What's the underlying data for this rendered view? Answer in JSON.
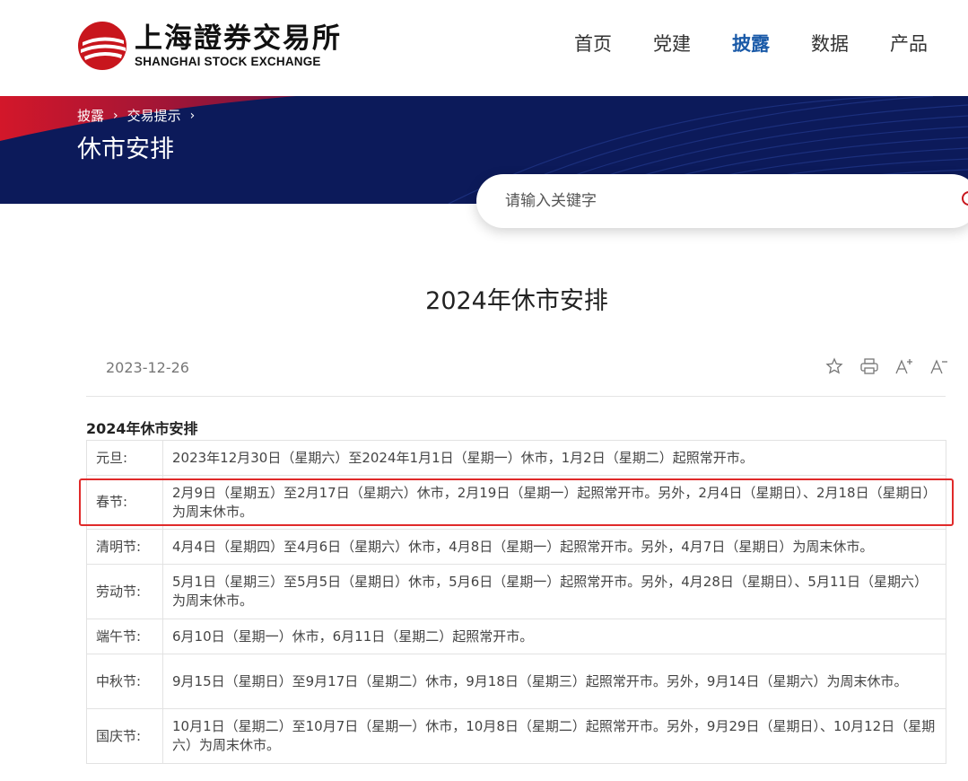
{
  "header": {
    "logo_cn": "上海證券交易所",
    "logo_en": "SHANGHAI STOCK EXCHANGE",
    "nav": [
      {
        "label": "首页",
        "active": false
      },
      {
        "label": "党建",
        "active": false
      },
      {
        "label": "披露",
        "active": true
      },
      {
        "label": "数据",
        "active": false
      },
      {
        "label": "产品",
        "active": false
      }
    ]
  },
  "banner": {
    "breadcrumb": [
      "披露",
      "交易提示"
    ],
    "title": "休市安排"
  },
  "search": {
    "placeholder": "请输入关键字",
    "icon": "search-icon"
  },
  "article": {
    "title": "2024年休市安排",
    "date": "2023-12-26",
    "tools": [
      "star-icon",
      "print-icon",
      "font-increase-icon",
      "font-decrease-icon"
    ],
    "table_caption": "2024年休市安排",
    "rows": [
      {
        "name": "元旦:",
        "desc": "2023年12月30日（星期六）至2024年1月1日（星期一）休市，1月2日（星期二）起照常开市。"
      },
      {
        "name": "春节:",
        "desc": "2月9日（星期五）至2月17日（星期六）休市，2月19日（星期一）起照常开市。另外，2月4日（星期日）、2月18日（星期日）为周末休市。"
      },
      {
        "name": "清明节:",
        "desc": "4月4日（星期四）至4月6日（星期六）休市，4月8日（星期一）起照常开市。另外，4月7日（星期日）为周末休市。"
      },
      {
        "name": "劳动节:",
        "desc": "5月1日（星期三）至5月5日（星期日）休市，5月6日（星期一）起照常开市。另外，4月28日（星期日）、5月11日（星期六）为周末休市。"
      },
      {
        "name": "端午节:",
        "desc": "6月10日（星期一）休市，6月11日（星期二）起照常开市。"
      },
      {
        "name": "中秋节:",
        "desc": "9月15日（星期日）至9月17日（星期二）休市，9月18日（星期三）起照常开市。另外，9月14日（星期六）为周末休市。"
      },
      {
        "name": "国庆节:",
        "desc": "10月1日（星期二）至10月7日（星期一）休市，10月8日（星期二）起照常开市。另外，9月29日（星期日）、10月12日（星期六）为周末休市。"
      }
    ]
  },
  "colors": {
    "brand_red": "#c8161d",
    "nav_active": "#1a5aa8",
    "banner_bg": "#0c1a5a",
    "highlight": "#e02a2a"
  }
}
